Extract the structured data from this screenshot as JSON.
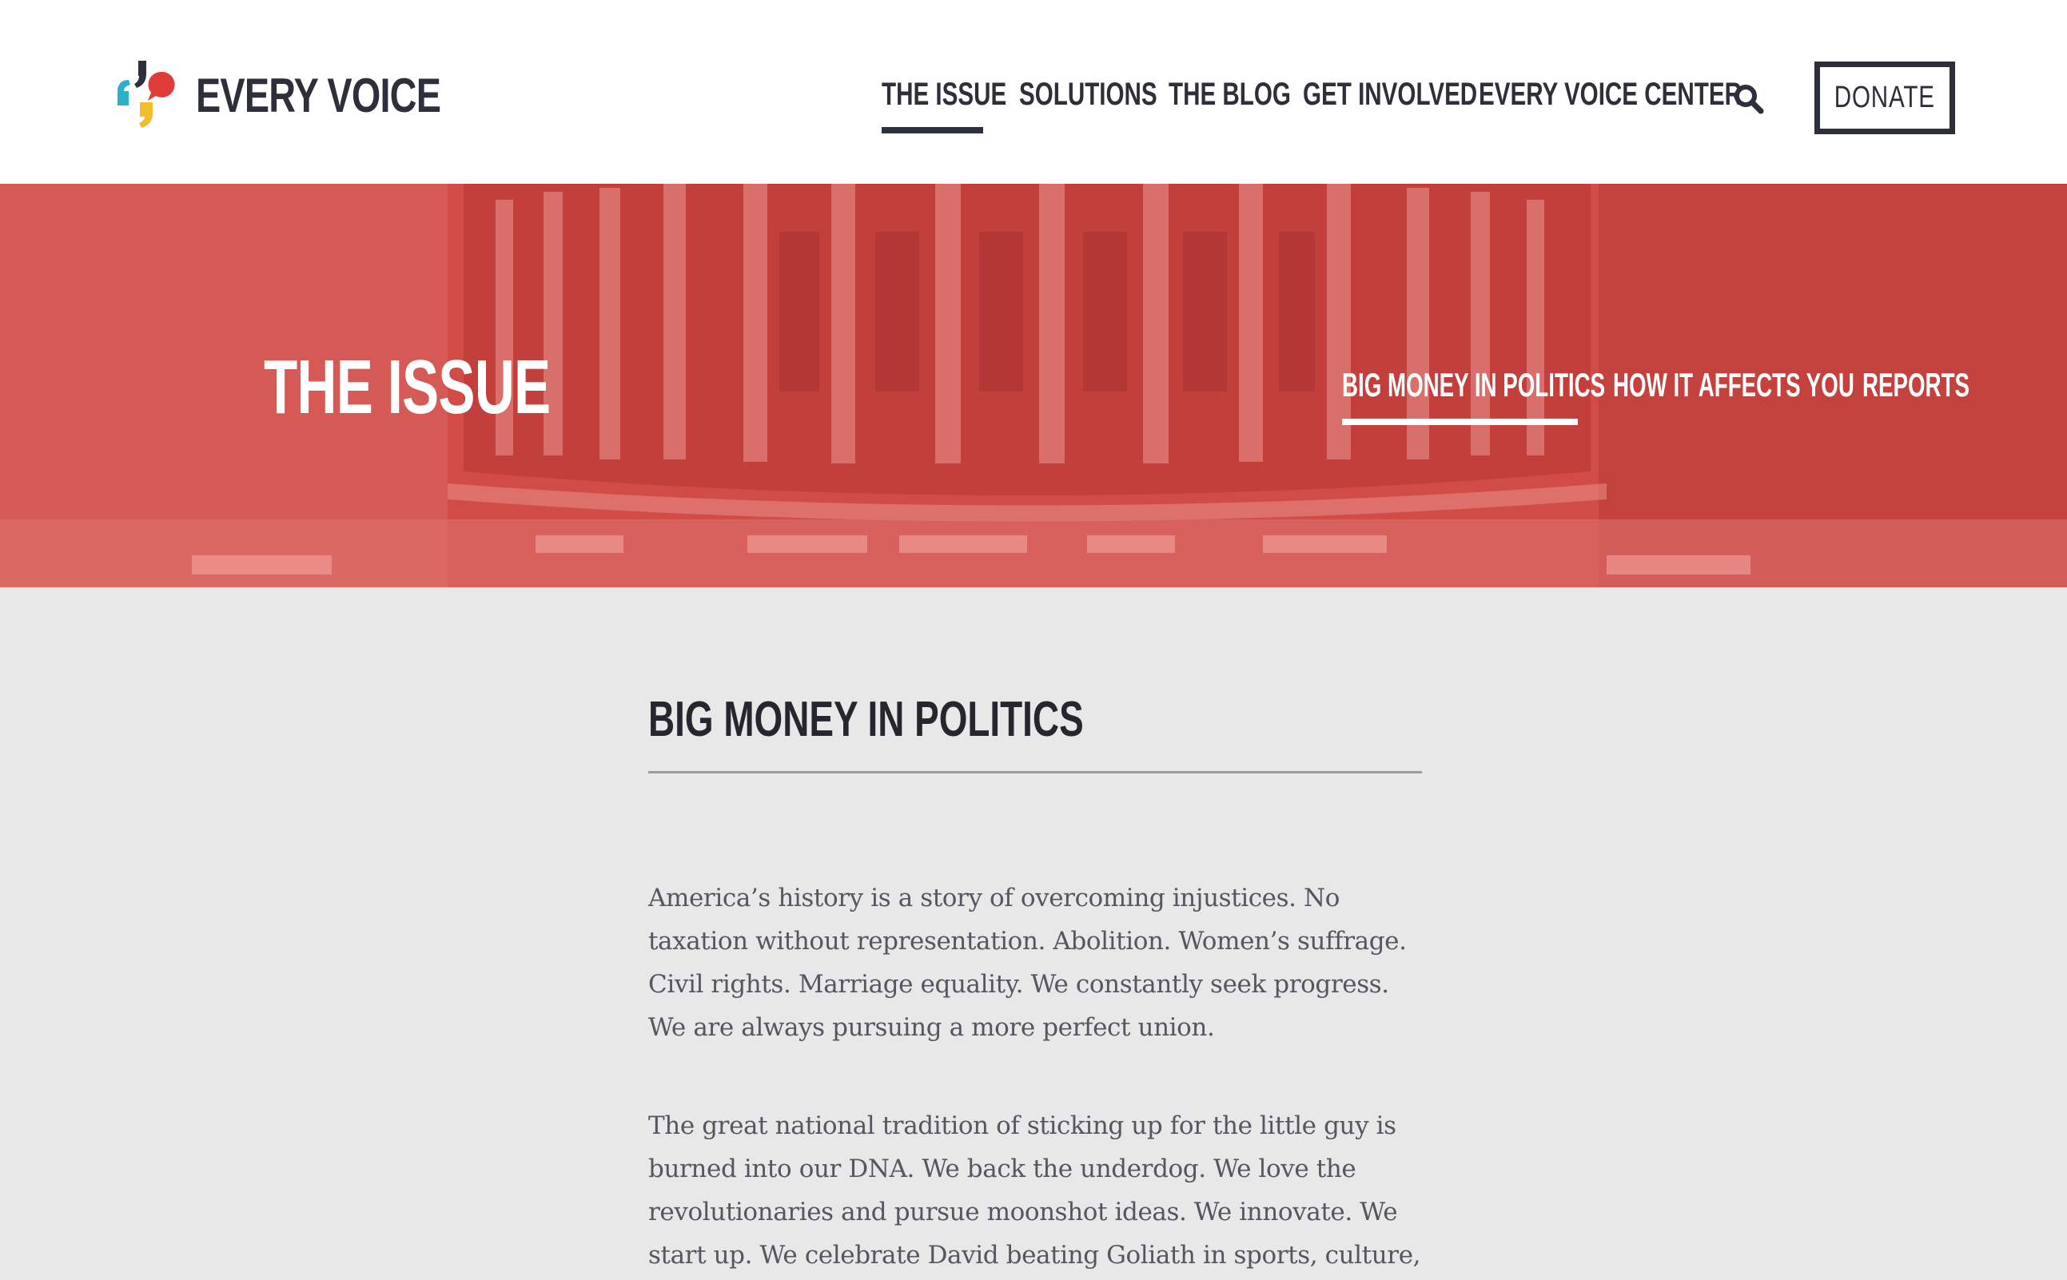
{
  "header": {
    "logo_text": "EVERY VOICE",
    "nav": [
      {
        "label": "THE ISSUE",
        "active": true
      },
      {
        "label": "SOLUTIONS"
      },
      {
        "label": "THE BLOG"
      },
      {
        "label": "GET INVOLVED"
      },
      {
        "label": "EVERY VOICE CENTER"
      }
    ],
    "search_icon": "search-icon",
    "donate_label": "DONATE"
  },
  "hero": {
    "title": "THE ISSUE",
    "subnav": [
      {
        "label": "BIG MONEY IN POLITICS",
        "active": true
      },
      {
        "label": "HOW IT AFFECTS YOU"
      },
      {
        "label": "REPORTS"
      }
    ]
  },
  "main": {
    "section_title": "BIG MONEY IN POLITICS",
    "paragraphs": [
      "America’s history is a story of overcoming injustices. No taxation without representation. Abolition. Women’s suffrage. Civil rights. Marriage equality. We constantly seek progress. We are always pursuing a more perfect union.",
      "The great national tradition of sticking up for the little guy is burned into our DNA. We back the underdog. We love the revolutionaries and pursue moonshot ideas. We innovate. We start up. We celebrate David beating Goliath in sports, culture,"
    ]
  },
  "colors": {
    "brand_dark": "#2d2f3a",
    "hero_red": "#d14b47",
    "page_bg": "#e8e8e9",
    "logo_teal": "#2eb0c8",
    "logo_yellow": "#f1bd2a",
    "logo_red": "#e03c3a"
  }
}
